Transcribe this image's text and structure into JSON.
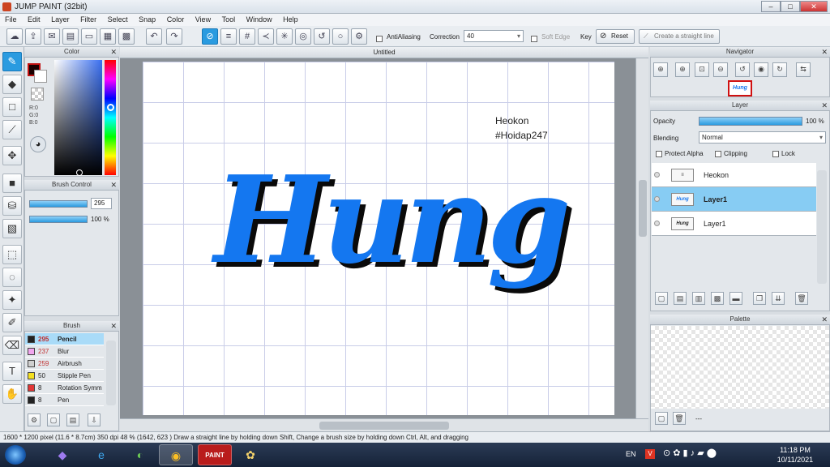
{
  "window": {
    "title": "JUMP PAINT (32bit)",
    "min": "–",
    "max": "□",
    "close": "✕"
  },
  "menu": [
    "File",
    "Edit",
    "Layer",
    "Filter",
    "Select",
    "Snap",
    "Color",
    "View",
    "Tool",
    "Window",
    "Help"
  ],
  "toolbar": {
    "antialiasing": "AntiAliasing",
    "correction_label": "Correction",
    "correction_value": "40",
    "soft_edge": "Soft Edge",
    "key_label": "Key",
    "reset_label": "Reset",
    "straight_line_label": "Create a straight line"
  },
  "color_panel": {
    "title": "Color",
    "r": "R:0",
    "g": "G:0",
    "b": "B:0"
  },
  "brush_control": {
    "title": "Brush Control",
    "size": "295",
    "opacity": "100 %"
  },
  "brush_panel": {
    "title": "Brush",
    "items": [
      {
        "size": "295",
        "name": "Pencil",
        "color": "#222222"
      },
      {
        "size": "237",
        "name": "Blur",
        "color": "#f1a6ee"
      },
      {
        "size": "259",
        "name": "Airbrush",
        "color": "#cfcfcf"
      },
      {
        "size": "50",
        "name": "Stipple Pen",
        "color": "#f4e021"
      },
      {
        "size": "8",
        "name": "Rotation Symm",
        "color": "#e23636"
      },
      {
        "size": "8",
        "name": "Pen",
        "color": "#222222"
      }
    ]
  },
  "canvas": {
    "tab": "Untitled",
    "text_line1": "Heokon",
    "text_line2": "#Hoidap247",
    "art_text": "Hung",
    "art_color": "#1477f0"
  },
  "navigator": {
    "title": "Navigator"
  },
  "layer_panel": {
    "title": "Layer",
    "opacity_label": "Opacity",
    "opacity_value": "100 %",
    "blending_label": "Blending",
    "blending_value": "Normal",
    "protect_alpha": "Protect Alpha",
    "clipping": "Clipping",
    "lock": "Lock",
    "layers": [
      "Heokon",
      "Layer1",
      "Layer1"
    ]
  },
  "palette": {
    "title": "Palette",
    "footer": "---"
  },
  "status": "1600 * 1200 pixel   (11.6 * 8.7cm)  350 dpi  48 %   (1642, 623 )   Draw a straight line by holding down Shift, Change a brush size by holding down Ctrl, Alt, and dragging",
  "taskbar": {
    "lang": "EN",
    "time": "11:18 PM",
    "date": "10/11/2021"
  }
}
